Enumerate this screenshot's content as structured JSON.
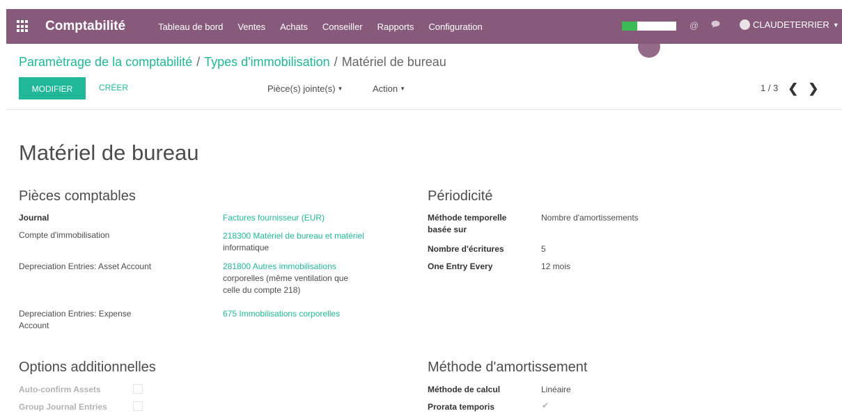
{
  "header": {
    "app_title": "Comptabilité",
    "menu": [
      {
        "label": "Tableau de bord"
      },
      {
        "label": "Ventes"
      },
      {
        "label": "Achats"
      },
      {
        "label": "Conseiller"
      },
      {
        "label": "Rapports"
      },
      {
        "label": "Configuration"
      }
    ],
    "progress_fraction": 0.28,
    "progress_color": "#3cba54",
    "user": "CLAUDETERRIER",
    "icons": [
      "apps-grid-icon",
      "at-icon",
      "chat-icon",
      "user-avatar-icon",
      "caret-down-icon"
    ]
  },
  "breadcrumb": {
    "level1": "Paramètrage de la comptabilité",
    "level2": "Types d'immobilisation",
    "current": "Matériel de bureau",
    "separator": "/"
  },
  "toolbar": {
    "edit_label": "MODIFIER",
    "create_label": "CRÉER",
    "attachments_label": "Pièce(s) jointe(s)",
    "action_label": "Action",
    "pager": "1 / 3"
  },
  "form": {
    "title": "Matériel de bureau",
    "journal_section": {
      "title": "Pièces comptables",
      "fields": [
        {
          "label": "Journal",
          "value": [
            "Factures fournisseur (EUR)"
          ]
        },
        {
          "label": "Compte d'immobilisation",
          "value": [
            "218300 Matériel de bureau et matériel",
            "informatique"
          ]
        },
        {
          "label": "Depreciation Entries: Asset Account",
          "value": [
            "281800 Autres immobilisations",
            "corporelles (même ventilation que",
            "celle du compte 218)"
          ]
        },
        {
          "label": [
            "Depreciation Entries: Expense",
            "Account"
          ],
          "value": [
            "675 Immobilisations corporelles"
          ]
        }
      ]
    },
    "periodicity_section": {
      "title": "Périodicité",
      "fields": [
        {
          "label": [
            "Méthode temporelle",
            "basée sur"
          ],
          "value": "Nombre d'amortissements"
        },
        {
          "label": "Nombre d'écritures",
          "value": "5"
        },
        {
          "label": "One Entry Every",
          "value": "12 mois"
        }
      ]
    },
    "options_section": {
      "title": "Options additionnelles",
      "fields": [
        {
          "label": "Auto-confirm Assets",
          "checked": false
        },
        {
          "label": "Group Journal Entries",
          "checked": false
        }
      ]
    },
    "depreciation_section": {
      "title": "Méthode d'amortissement",
      "fields": [
        {
          "label": "Méthode de calcul",
          "value": "Linéaire"
        },
        {
          "label": "Prorata temporis",
          "checked": true,
          "check_glyph": "✔"
        }
      ]
    }
  },
  "colors": {
    "brand": "#875a7b",
    "accent": "#21b799"
  }
}
